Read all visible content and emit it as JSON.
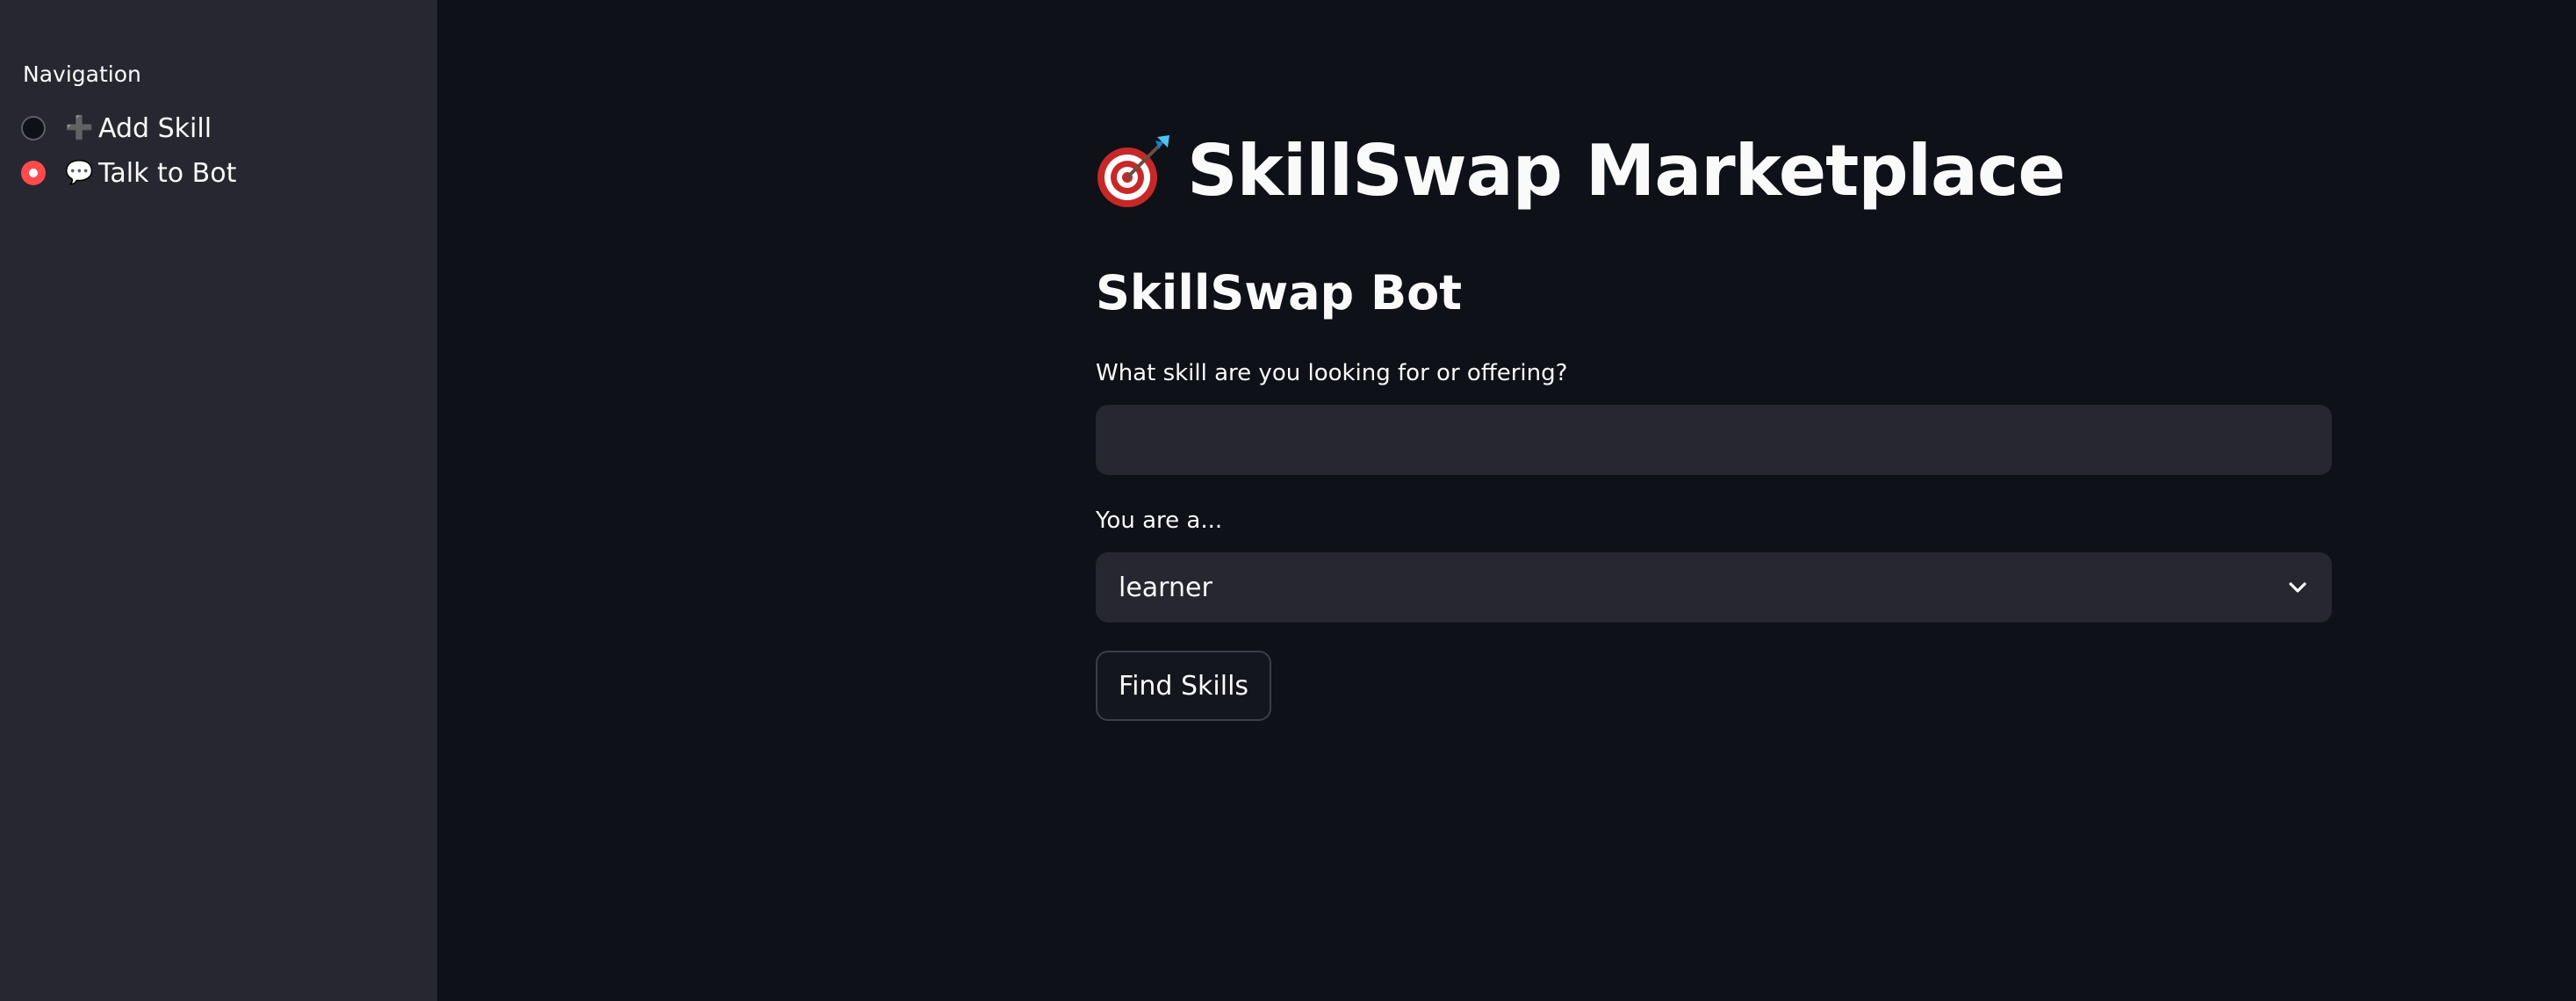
{
  "sidebar": {
    "nav_label": "Navigation",
    "options": [
      {
        "icon": "plus-icon",
        "glyph": "➕",
        "label": "Add Skill",
        "selected": false
      },
      {
        "icon": "speech-bubble-icon",
        "glyph": "💬",
        "label": "Talk to Bot",
        "selected": true
      }
    ]
  },
  "header": {
    "title_icon": "direct-hit-target-icon",
    "title": "SkillSwap Marketplace",
    "subheader": "SkillSwap Bot"
  },
  "form": {
    "skill_label": "What skill are you looking for or offering?",
    "skill_value": "",
    "skill_placeholder": "",
    "role_label": "You are a...",
    "role_selected": "learner",
    "submit_label": "Find Skills"
  },
  "colors": {
    "background": "#0e1117",
    "sidebar": "#262730",
    "accent": "#ff4b4b",
    "input_bg": "#262730",
    "text": "#fafafa"
  }
}
